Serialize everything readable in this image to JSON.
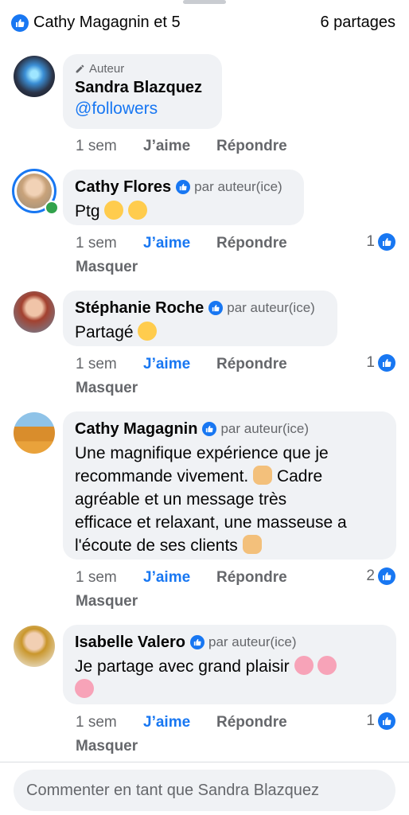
{
  "top": {
    "reactors": "Cathy Magagnin et 5",
    "shares": "6 partages"
  },
  "comments": [
    {
      "author_label": "Auteur",
      "author": "Sandra Blazquez",
      "mention": "@followers",
      "time": "1 sem",
      "like": "J’aime",
      "reply": "Répondre"
    },
    {
      "author": "Cathy Flores",
      "par": "par auteur(ice)",
      "text": "Ptg",
      "time": "1 sem",
      "like": "J’aime",
      "reply": "Répondre",
      "count": "1",
      "hide": "Masquer"
    },
    {
      "author": "Stéphanie Roche",
      "par": "par auteur(ice)",
      "text": "Partagé",
      "time": "1 sem",
      "like": "J’aime",
      "reply": "Répondre",
      "count": "1",
      "hide": "Masquer"
    },
    {
      "author": "Cathy Magagnin",
      "par": "par auteur(ice)",
      "text_lines": [
        "Une magnifique expérience que je",
        "recommande vivement.",
        "Cadre",
        "agréable et un message très",
        "efficace et relaxant, une masseuse a",
        "l'écoute de ses clients"
      ],
      "time": "1 sem",
      "like": "J’aime",
      "reply": "Répondre",
      "count": "2",
      "hide": "Masquer"
    },
    {
      "author": "Isabelle Valero",
      "par": "par auteur(ice)",
      "text": "Je partage avec grand plaisir",
      "time": "1 sem",
      "like": "J’aime",
      "reply": "Répondre",
      "count": "1",
      "hide": "Masquer"
    }
  ],
  "composer": {
    "placeholder": "Commenter en tant que Sandra Blazquez"
  },
  "colors": {
    "accent": "#1877f2",
    "bubble": "#f0f2f5",
    "muted": "#65676b",
    "online": "#31a24c"
  },
  "icons": [
    "like-icon",
    "pencil-icon",
    "verified-badge-icon"
  ]
}
